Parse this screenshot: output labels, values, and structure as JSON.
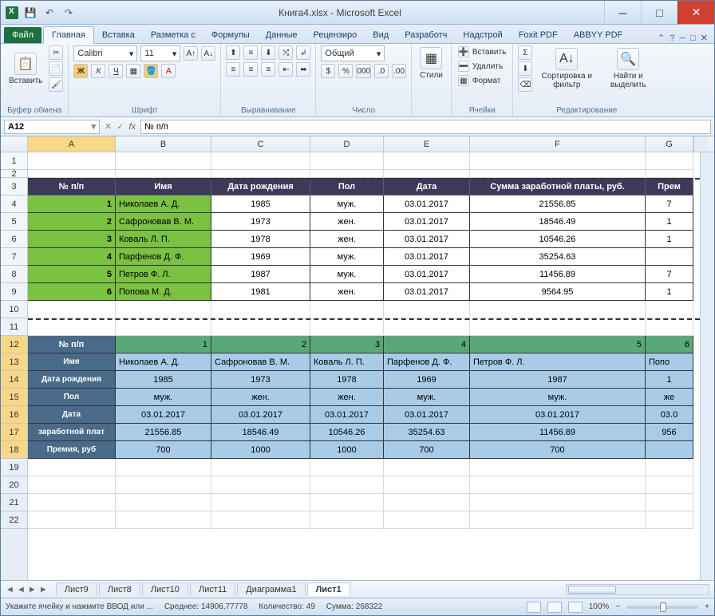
{
  "title": "Книга4.xlsx  -  Microsoft Excel",
  "qat": {
    "save": "💾",
    "undo": "↶",
    "redo": "↷"
  },
  "tabs": {
    "file": "Файл",
    "home": "Главная",
    "insert": "Вставка",
    "layout": "Разметка с",
    "formulas": "Формулы",
    "data": "Данные",
    "review": "Рецензиро",
    "view": "Вид",
    "developer": "Разработч",
    "addins": "Надстрой",
    "foxit": "Foxit PDF",
    "abbyy": "ABBYY PDF"
  },
  "ribbon": {
    "clipboard": {
      "paste": "Вставить",
      "label": "Буфер обмена"
    },
    "font": {
      "name": "Calibri",
      "size": "11",
      "bold": "Ж",
      "italic": "К",
      "under": "Ч",
      "label": "Шрифт"
    },
    "align": {
      "label": "Выравнивание"
    },
    "number": {
      "format": "Общий",
      "label": "Число"
    },
    "styles": {
      "btn": "Стили"
    },
    "cells": {
      "insert": "Вставить",
      "delete": "Удалить",
      "format": "Формат",
      "label": "Ячейки"
    },
    "edit": {
      "sort": "Сортировка и фильтр",
      "find": "Найти и выделить",
      "label": "Редактирование"
    }
  },
  "namebox": "A12",
  "formula": "№ п/п",
  "cols": [
    "A",
    "B",
    "C",
    "D",
    "E",
    "F",
    "G"
  ],
  "rows": [
    "1",
    "2",
    "3",
    "4",
    "5",
    "6",
    "7",
    "8",
    "9",
    "10",
    "11",
    "12",
    "13",
    "14",
    "15",
    "16",
    "17",
    "18",
    "19",
    "20",
    "21",
    "22"
  ],
  "table1": {
    "headers": [
      "№ п/п",
      "Имя",
      "Дата рождения",
      "Пол",
      "Дата",
      "Сумма заработной платы, руб.",
      "Прем"
    ],
    "rows": [
      [
        "1",
        "Николаев А. Д.",
        "1985",
        "муж.",
        "03.01.2017",
        "21556.85",
        "7"
      ],
      [
        "2",
        "Сафроновав В. М.",
        "1973",
        "жен.",
        "03.01.2017",
        "18546.49",
        "1"
      ],
      [
        "3",
        "Коваль Л. П.",
        "1978",
        "жен.",
        "03.01.2017",
        "10546.26",
        "1"
      ],
      [
        "4",
        "Парфенов Д. Ф.",
        "1969",
        "муж.",
        "03.01.2017",
        "35254.63",
        ""
      ],
      [
        "5",
        "Петров Ф. Л.",
        "1987",
        "муж.",
        "03.01.2017",
        "11456.89",
        "7"
      ],
      [
        "6",
        "Попова М. Д.",
        "1981",
        "жен.",
        "03.01.2017",
        "9564.95",
        "1"
      ]
    ]
  },
  "table2": {
    "sideHeaders": [
      "№ п/п",
      "Имя",
      "Дата рождения",
      "Пол",
      "Дата",
      "заработной плат",
      "Премия, руб"
    ],
    "cols": [
      {
        "n": "1",
        "name": "Николаев А. Д.",
        "birth": "1985",
        "sex": "муж.",
        "date": "03.01.2017",
        "sal": "21556.85",
        "bonus": "700"
      },
      {
        "n": "2",
        "name": "Сафроновав В. М.",
        "birth": "1973",
        "sex": "жен.",
        "date": "03.01.2017",
        "sal": "18546.49",
        "bonus": "1000"
      },
      {
        "n": "3",
        "name": "Коваль Л. П.",
        "birth": "1978",
        "sex": "жен.",
        "date": "03.01.2017",
        "sal": "10546.26",
        "bonus": "1000"
      },
      {
        "n": "4",
        "name": "Парфенов Д. Ф.",
        "birth": "1969",
        "sex": "муж.",
        "date": "03.01.2017",
        "sal": "35254.63",
        "bonus": "700"
      },
      {
        "n": "5",
        "name": "Петров Ф. Л.",
        "birth": "1987",
        "sex": "муж.",
        "date": "03.01.2017",
        "sal": "11456.89",
        "bonus": "700"
      },
      {
        "n": "6",
        "name": "Попо",
        "birth": "1",
        "sex": "же",
        "date": "03.0",
        "sal": "956",
        "bonus": ""
      }
    ]
  },
  "sheets": [
    "Лист9",
    "Лист8",
    "Лист10",
    "Лист11",
    "Диаграмма1",
    "Лист1"
  ],
  "activeSheet": "Лист1",
  "status": {
    "hint": "Укажите ячейку и нажмите ВВОД или ...",
    "avg": "Среднее: 14906,77778",
    "count": "Количество: 49",
    "sum": "Сумма: 268322",
    "zoom": "100%"
  },
  "winctl": {
    "min": "─",
    "max": "□",
    "close": "✕"
  }
}
